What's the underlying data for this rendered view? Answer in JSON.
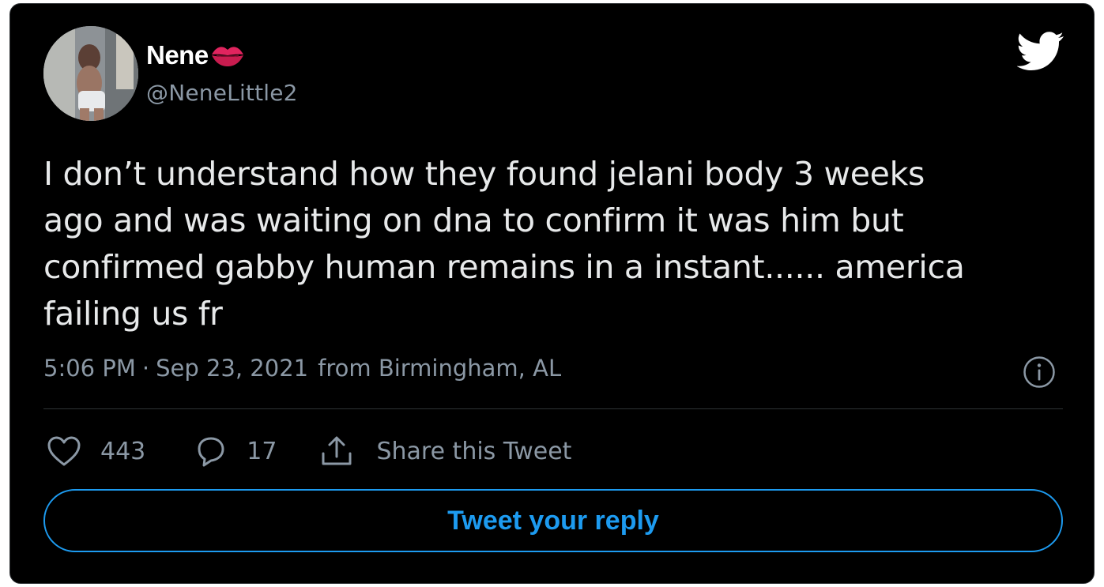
{
  "author": {
    "display_name": "Nene",
    "handle": "@NeneLittle2",
    "name_emoji": "lips-icon",
    "avatar": "avatar-photo"
  },
  "tweet": {
    "text": "I don’t understand how they found jelani body 3 weeks\nago and was waiting on dna to confirm it was him but\nconfirmed gabby human remains in a instant...... america\nfailing us fr",
    "time": "5:06 PM",
    "separator": "·",
    "date": "Sep 23, 2021",
    "location": "from Birmingham, AL"
  },
  "actions": {
    "likes": "443",
    "replies": "17",
    "share_label": "Share this Tweet"
  },
  "reply_button": {
    "label": "Tweet your reply"
  },
  "icons": {
    "brand": "twitter-bird-icon",
    "info": "info-icon",
    "like": "heart-icon",
    "reply": "speech-bubble-icon",
    "share": "share-icon"
  },
  "colors": {
    "background": "#000000",
    "text": "#e7e9ea",
    "secondary": "#8b98a5",
    "accent": "#1d9bf0",
    "lips": "#e0245e"
  }
}
